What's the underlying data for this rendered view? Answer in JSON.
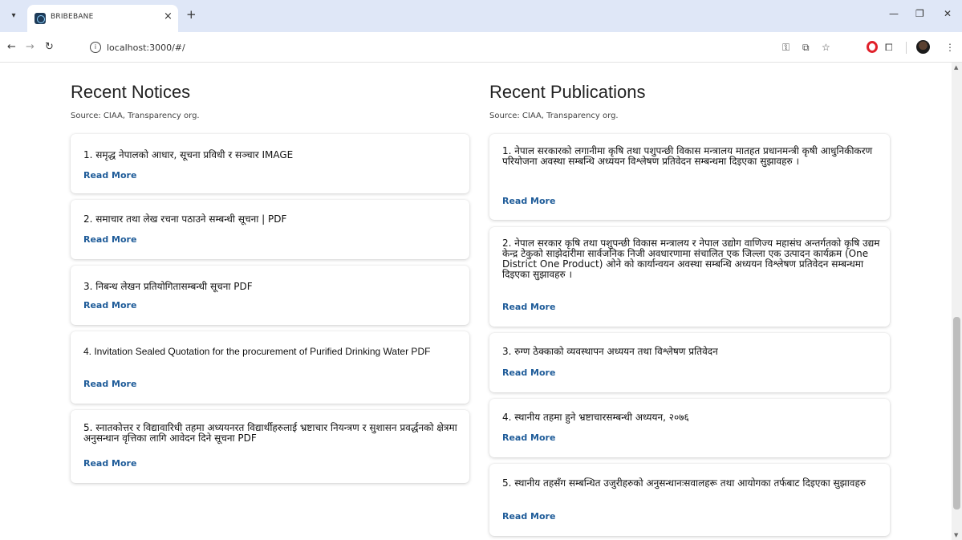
{
  "browser": {
    "tab_title": "BRIBEBANE",
    "url": "localhost:3000/#/"
  },
  "notices": {
    "title": "Recent Notices",
    "source": "Source: CIAA, Transparency org.",
    "items": [
      {
        "text": "1. समृद्ध नेपालको आधार, सूचना प्रविधी र सञ्चार IMAGE",
        "link": "Read More"
      },
      {
        "text": "2. समाचार तथा लेख रचना पठाउने सम्बन्धी सूचना | PDF",
        "link": "Read More"
      },
      {
        "text": "3. निबन्ध लेखन प्रतियोगितासम्बन्धी सूचना PDF",
        "link": "Read More"
      },
      {
        "text": "4. Invitation Sealed Quotation for the procurement of Purified Drinking Water PDF",
        "link": "Read More"
      },
      {
        "text": "5. स्नातकोत्तर र विद्यावारिधी तहमा अध्ययनरत विद्यार्थीहरुलाई भ्रष्टाचार नियन्त्रण र सुशासन प्रवर्द्धनको क्षेत्रमा अनुसन्धान वृत्तिका लागि आवेदन दिने सूचना PDF",
        "link": "Read More"
      }
    ]
  },
  "publications": {
    "title": "Recent Publications",
    "source": "Source: CIAA, Transparency org.",
    "items": [
      {
        "text": "1. नेपाल सरकारको लगानीमा कृषि तथा पशुपन्छी विकास मन्त्रालय मातहत प्रधानमन्त्री कृषी आधुनिकीकरण परियोजना अवस्था सम्बन्धि अध्ययन विश्लेषण प्रतिवेदन सम्बन्धमा दिइएका सुझावहरु ।",
        "link": "Read More"
      },
      {
        "text": "2. नेपाल सरकार कृषि तथा पशुपन्छी विकास मन्त्रालय र नेपाल उद्योग वाणिज्य महासंघ अन्तर्गतको कृषि उद्यम केन्द्र टेकुको साझेदारीमा सार्वजनिक निजी अवधारणामा संचालित एक जिल्ला एक उत्पादन कार्यक्रम (One District One Product) ओने को कार्यान्वयन अवस्था सम्बन्धि अध्ययन विश्लेषण प्रतिवेदन सम्बन्धमा दिइएका सुझावहरु ।",
        "link": "Read More"
      },
      {
        "text": "3. रुग्ण ठेक्काको व्यवस्थापन अध्ययन तथा विश्लेषण प्रतिवेदन",
        "link": "Read More"
      },
      {
        "text": "4. स्थानीय तहमा हुने भ्रष्टाचारसम्बन्धी अध्ययन, २०७६",
        "link": "Read More"
      },
      {
        "text": "5. स्थानीय तहसँग सम्बन्धित उजुरीहरुको अनुसन्धानःसवालहरू तथा आयोगका तर्फबाट दिइएका सुझावहरु",
        "link": "Read More"
      }
    ]
  }
}
